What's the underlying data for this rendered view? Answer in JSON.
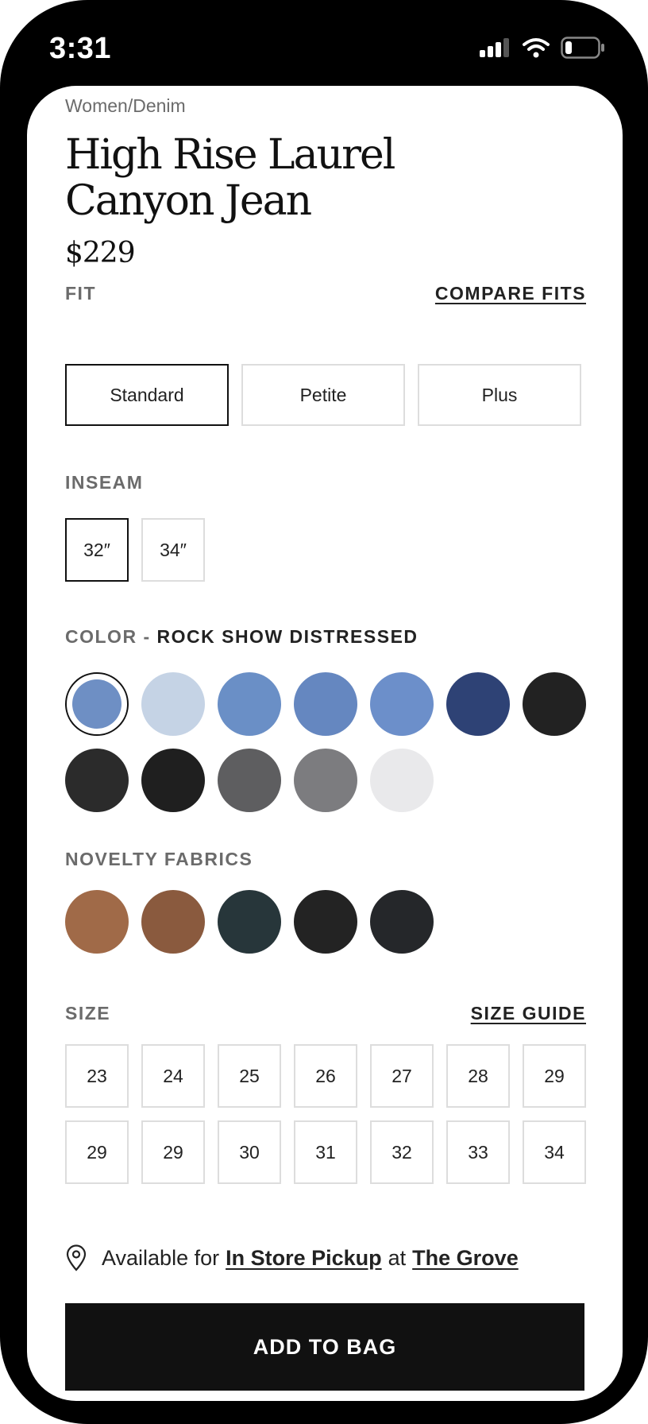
{
  "status_bar": {
    "time": "3:31"
  },
  "breadcrumb": "Women/Denim",
  "product": {
    "title_line1": "High Rise Laurel",
    "title_line2": "Canyon Jean",
    "price": "$229"
  },
  "fit": {
    "label": "FIT",
    "compare_link": "COMPARE FITS",
    "options": [
      "Standard",
      "Petite",
      "Plus"
    ],
    "selected": "Standard"
  },
  "inseam": {
    "label": "INSEAM",
    "options": [
      "32″",
      "34″"
    ],
    "selected": "32″"
  },
  "color": {
    "label": "COLOR - ",
    "selected_name": "ROCK SHOW DISTRESSED",
    "swatch_colors": [
      "#6e8fc4",
      "#c5d3e5",
      "#6a8fc6",
      "#6587c0",
      "#6c8fca",
      "#2e4275",
      "#222222",
      "#2b2b2b",
      "#1f1f1f",
      "#5e5e60",
      "#7c7c7f",
      "#e9e9eb"
    ]
  },
  "novelty": {
    "label": "NOVELTY FABRICS",
    "swatch_colors": [
      "#a06a48",
      "#8a5a3e",
      "#27363a",
      "#232323",
      "#25272a"
    ]
  },
  "size": {
    "label": "SIZE",
    "guide_link": "SIZE GUIDE",
    "row1": [
      "23",
      "24",
      "25",
      "26",
      "27",
      "28",
      "29"
    ],
    "row2": [
      "29",
      "29",
      "30",
      "31",
      "32",
      "33",
      "34"
    ]
  },
  "pickup": {
    "prefix": "Available for",
    "method": "In Store Pickup",
    "connector": "at",
    "store": "The Grove"
  },
  "cta": {
    "add_to_bag": "ADD TO BAG"
  }
}
